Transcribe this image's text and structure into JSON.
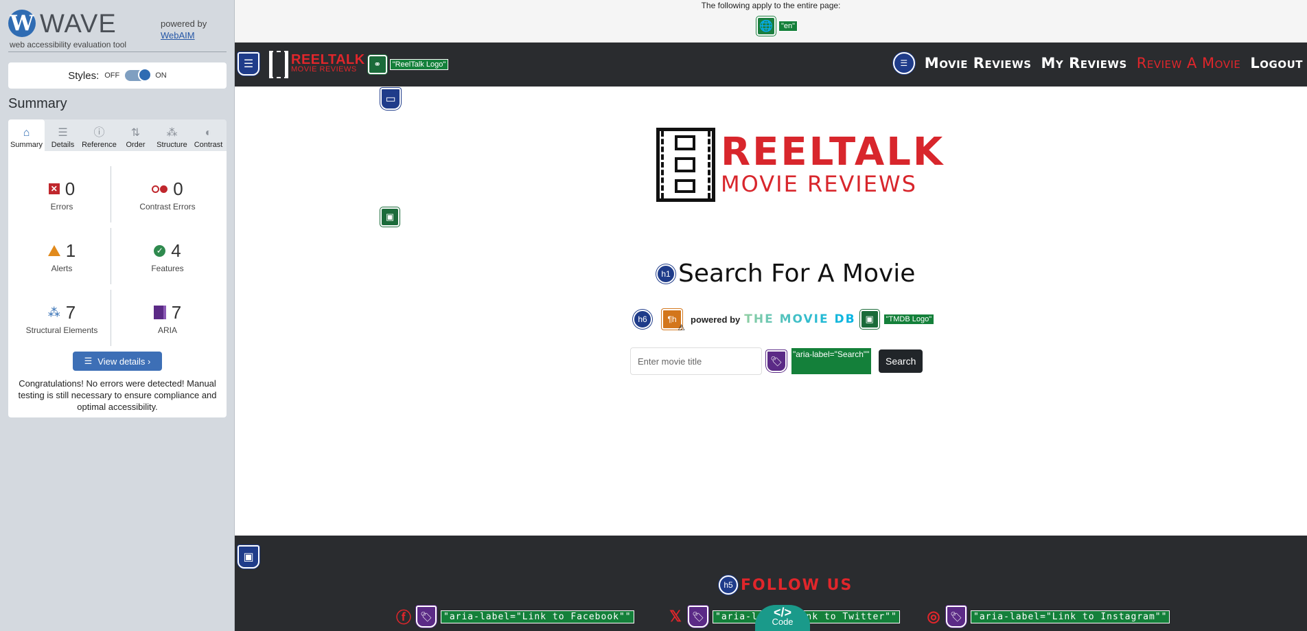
{
  "wave": {
    "logo_letter": "W",
    "logo_text": "WAVE",
    "tagline": "web accessibility evaluation tool",
    "powered_by": "powered by",
    "webaim_link": "WebAIM",
    "styles_label": "Styles:",
    "toggle_off": "OFF",
    "toggle_on": "ON",
    "summary_title": "Summary",
    "tabs": [
      {
        "label": "Summary",
        "icon": "home-icon",
        "glyph": "⌂"
      },
      {
        "label": "Details",
        "icon": "list-icon",
        "glyph": "☰"
      },
      {
        "label": "Reference",
        "icon": "info-icon",
        "glyph": "ⓘ"
      },
      {
        "label": "Order",
        "icon": "order-icon",
        "glyph": "⇅"
      },
      {
        "label": "Structure",
        "icon": "structure-icon",
        "glyph": "⁂"
      },
      {
        "label": "Contrast",
        "icon": "contrast-icon",
        "glyph": "◐"
      }
    ],
    "stats": {
      "errors": {
        "value": "0",
        "label": "Errors"
      },
      "contrast_errors": {
        "value": "0",
        "label": "Contrast Errors"
      },
      "alerts": {
        "value": "1",
        "label": "Alerts"
      },
      "features": {
        "value": "4",
        "label": "Features"
      },
      "structural": {
        "value": "7",
        "label": "Structural Elements"
      },
      "aria": {
        "value": "7",
        "label": "ARIA"
      }
    },
    "view_details": "View details ›",
    "congrats": "Congratulations! No errors were detected! Manual testing is still necessary to ensure compliance and optimal accessibility."
  },
  "page": {
    "lang_title": "The following apply to the entire page:",
    "lang_value": "\"en\"",
    "nav": {
      "brand_line1": "REELTALK",
      "brand_line2": "MOVIE REVIEWS",
      "logo_alt": "\"ReelTalk Logo\"",
      "links": [
        "Movie Reviews",
        "My Reviews",
        "Review A Movie",
        "Logout"
      ]
    },
    "hero": {
      "line1": "REELTALK",
      "line2": "MOVIE REVIEWS"
    },
    "h1_badge": "h1",
    "title": "Search For A Movie",
    "h6_badge": "h6",
    "powered_by": "powered by",
    "tmdb_text": "THE MOVIE DB",
    "tmdb_alt": "\"TMDB Logo\"",
    "search": {
      "placeholder": "Enter movie title",
      "aria_label": "\"aria-label=\"Search\"\"",
      "button": "Search"
    },
    "footer": {
      "h5_badge": "h5",
      "follow": "FOLLOW US",
      "facebook_label": "\"aria-label=\"Link to Facebook\"\"",
      "twitter_label": "\"aria-label=\"Link to Twitter\"\"",
      "instagram_label": "\"aria-label=\"Link to Instagram\"\""
    },
    "code_button": {
      "symbol": "</>",
      "label": "Code"
    }
  },
  "colors": {
    "wave_blue": "#2f6cb3",
    "brand_red": "#e0262b",
    "wave_green": "#14803a",
    "aria_purple": "#5b2a86",
    "navbar": "#2a2c2f"
  }
}
